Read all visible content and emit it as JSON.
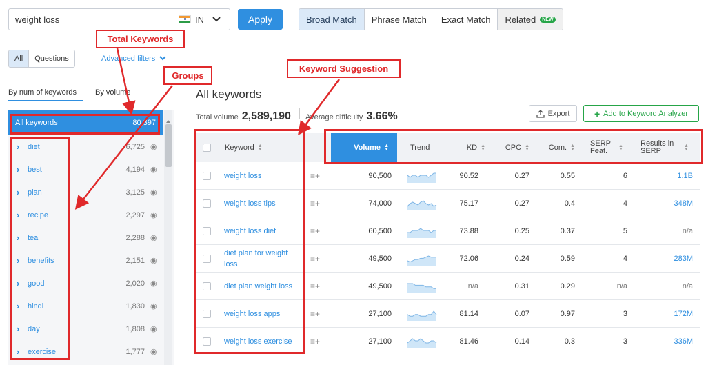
{
  "search": {
    "query": "weight loss",
    "database": "IN",
    "apply_label": "Apply"
  },
  "match_tabs": [
    {
      "label": "Broad Match",
      "active": true
    },
    {
      "label": "Phrase Match",
      "active": false
    },
    {
      "label": "Exact Match",
      "active": false
    },
    {
      "label": "Related",
      "active": false,
      "badge": "NEW"
    }
  ],
  "filters": {
    "all_label": "All",
    "questions_label": "Questions",
    "advanced_label": "Advanced filters"
  },
  "sidebar": {
    "tab_num": "By num of keywords",
    "tab_volume": "By volume",
    "all_label": "All keywords",
    "all_count": "80,397",
    "groups": [
      {
        "name": "diet",
        "count": "6,725"
      },
      {
        "name": "best",
        "count": "4,194"
      },
      {
        "name": "plan",
        "count": "3,125"
      },
      {
        "name": "recipe",
        "count": "2,297"
      },
      {
        "name": "tea",
        "count": "2,288"
      },
      {
        "name": "benefits",
        "count": "2,151"
      },
      {
        "name": "good",
        "count": "2,020"
      },
      {
        "name": "hindi",
        "count": "1,830"
      },
      {
        "name": "day",
        "count": "1,808"
      },
      {
        "name": "exercise",
        "count": "1,777"
      }
    ]
  },
  "main": {
    "title": "All keywords",
    "total_volume_label": "Total volume",
    "total_volume": "2,589,190",
    "avg_difficulty_label": "Average difficulty",
    "avg_difficulty": "3.66%",
    "export_label": "Export",
    "add_label": "Add to Keyword Analyzer"
  },
  "table": {
    "headers": {
      "keyword": "Keyword",
      "volume": "Volume",
      "trend": "Trend",
      "kd": "KD",
      "cpc": "CPC",
      "com": "Com.",
      "serp": "SERP Feat.",
      "results": "Results in SERP"
    },
    "rows": [
      {
        "keyword": "weight loss",
        "volume": "90,500",
        "kd": "90.52",
        "cpc": "0.27",
        "com": "0.55",
        "serp": "6",
        "results": "1.1B",
        "trend": [
          6,
          5,
          6,
          6,
          5,
          6,
          6,
          6,
          5,
          6,
          7,
          7
        ]
      },
      {
        "keyword": "weight loss tips",
        "volume": "74,000",
        "kd": "75.17",
        "cpc": "0.27",
        "com": "0.4",
        "serp": "4",
        "results": "348M",
        "trend": [
          5,
          7,
          8,
          7,
          6,
          8,
          9,
          7,
          6,
          7,
          5,
          6
        ]
      },
      {
        "keyword": "weight loss diet",
        "volume": "60,500",
        "kd": "73.88",
        "cpc": "0.25",
        "com": "0.37",
        "serp": "5",
        "results": "n/a",
        "trend": [
          5,
          5,
          6,
          6,
          6,
          7,
          6,
          6,
          6,
          5,
          6,
          6
        ]
      },
      {
        "keyword": "diet plan for weight loss",
        "volume": "49,500",
        "kd": "72.06",
        "cpc": "0.24",
        "com": "0.59",
        "serp": "4",
        "results": "283M",
        "trend": [
          4,
          3,
          4,
          5,
          5,
          6,
          6,
          7,
          8,
          7,
          7,
          7
        ]
      },
      {
        "keyword": "diet plan weight loss",
        "volume": "49,500",
        "kd": "n/a",
        "cpc": "0.31",
        "com": "0.29",
        "serp": "n/a",
        "results": "n/a",
        "trend": [
          7,
          7,
          7,
          6,
          6,
          6,
          6,
          5,
          5,
          5,
          4,
          4
        ]
      },
      {
        "keyword": "weight loss apps",
        "volume": "27,100",
        "kd": "81.14",
        "cpc": "0.07",
        "com": "0.97",
        "serp": "3",
        "results": "172M",
        "trend": [
          6,
          5,
          5,
          6,
          6,
          5,
          5,
          5,
          6,
          6,
          8,
          6
        ]
      },
      {
        "keyword": "weight loss exercise",
        "volume": "27,100",
        "kd": "81.46",
        "cpc": "0.14",
        "com": "0.3",
        "serp": "3",
        "results": "336M",
        "trend": [
          5,
          6,
          7,
          6,
          6,
          7,
          6,
          5,
          5,
          6,
          6,
          5
        ]
      }
    ]
  },
  "annotations": {
    "total_keywords": "Total Keywords",
    "groups": "Groups",
    "keyword_suggestion": "Keyword Suggestion"
  },
  "colors": {
    "accent": "#2f8fe0",
    "annotation": "#e0292b",
    "positive": "#26a548"
  }
}
